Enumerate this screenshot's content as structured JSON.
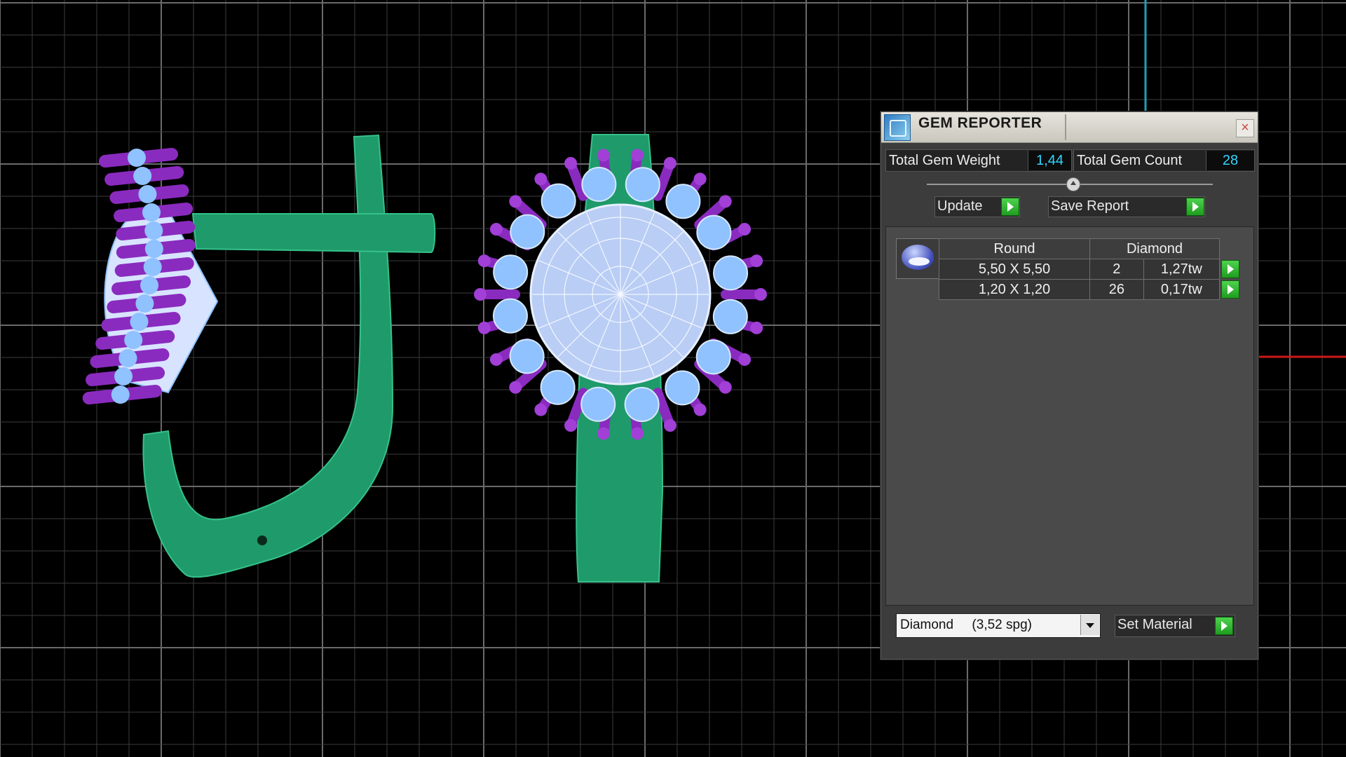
{
  "panel": {
    "title": "GEM REPORTER",
    "close_glyph": "×",
    "total_gem_weight_label": "Total Gem Weight",
    "total_gem_weight": "1,44",
    "total_gem_count_label": "Total Gem Count",
    "total_gem_count": "28",
    "update_label": "Update",
    "save_report_label": "Save Report",
    "gem_header": {
      "shape": "Round",
      "material": "Diamond"
    },
    "gems": [
      {
        "size": "5,50 X 5,50",
        "count": "2",
        "weight": "1,27tw"
      },
      {
        "size": "1,20 X 1,20",
        "count": "26",
        "weight": "0,17tw"
      }
    ],
    "material_select": "Diamond     (3,52 spg)",
    "set_material_label": "Set Material"
  },
  "colors": {
    "metal": "#1f9a6a",
    "prong": "#8a2bbf",
    "gem": "#8fc2ff",
    "axis_x": "#d01818",
    "axis_y": "#1ea0b8",
    "value_text": "#33d6ff"
  },
  "icons": {
    "app": "gem-reporter-icon",
    "play": "green-arrow-icon",
    "dropdown": "chevron-down-icon"
  }
}
